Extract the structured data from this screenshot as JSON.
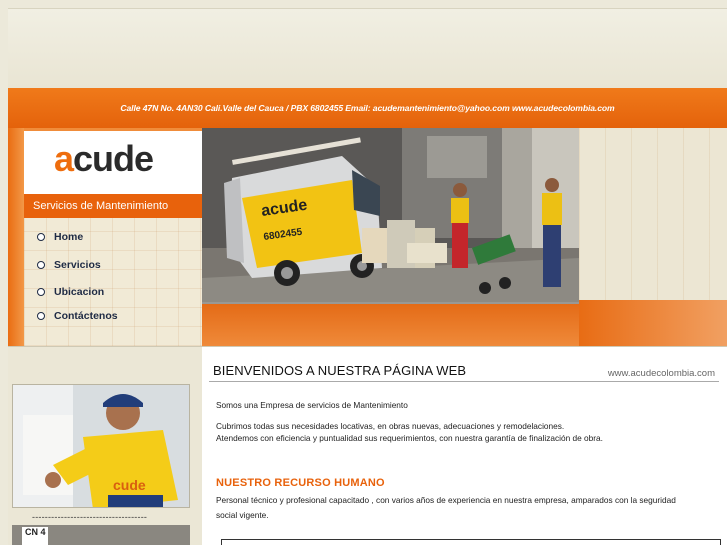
{
  "header": {
    "address": "Calle 47N No. 4AN30 Cali.Valle del Cauca / PBX 6802455 Email: acudemantenimiento@yahoo.com www.acudecolombia.com"
  },
  "logo": {
    "text_a": "a",
    "text_rest": "cude"
  },
  "sidebar": {
    "services_title": "Servicios de Mantenimiento",
    "items": [
      {
        "label": "Home"
      },
      {
        "label": "Servicios"
      },
      {
        "label": "Ubicacion"
      },
      {
        "label": "Contáctenos"
      }
    ],
    "separator": "------------------------------------"
  },
  "hero": {
    "van_text": "acude",
    "van_phone": "6802455"
  },
  "main": {
    "title": "BIENVENIDOS  A NUESTRA PÁGINA WEB",
    "site_url": "www.acudecolombia.com",
    "intro": "Somos una Empresa de servicios de Mantenimiento",
    "para2_line1": "Cubrimos  todas sus necesidades locativas, en obras nuevas, adecuaciones y remodelaciones.",
    "para2_line2": "Atendemos  con eficiencia y puntualidad sus requerimientos, con nuestra garantía  de finalización de obra.",
    "section_title": "NUESTRO  RECURSO HUMANO",
    "hr_line1": "Personal técnico y profesional capacitado , con varios años de experiencia en nuestra    empresa, amparados con  la seguridad",
    "hr_line2": "social vigente."
  },
  "photo2": {
    "tag": "CN 4"
  },
  "colors": {
    "accent": "#e8620c",
    "nav_text": "#1e2a44",
    "background": "#ece9da"
  }
}
